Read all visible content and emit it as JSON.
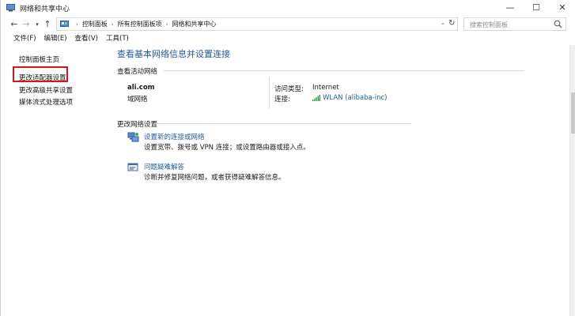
{
  "window": {
    "title": "网络和共享中心",
    "controls": {
      "minimize": "—",
      "maximize": "☐",
      "close": "✕"
    }
  },
  "address_bar": {
    "breadcrumbs": [
      "控制面板",
      "所有控制面板项",
      "网络和共享中心"
    ],
    "search_placeholder": "搜索控制面板"
  },
  "menu": [
    "文件(F)",
    "编辑(E)",
    "查看(V)",
    "工具(T)"
  ],
  "sidebar": {
    "items": [
      {
        "label": "控制面板主页"
      },
      {
        "label": "更改适配器设置",
        "highlighted": true
      },
      {
        "label": "更改高级共享设置"
      },
      {
        "label": "媒体流式处理选项"
      }
    ],
    "highlight_color": "#d4161c"
  },
  "main": {
    "title": "查看基本网络信息并设置连接",
    "active_networks_header": "查看活动网络",
    "network": {
      "name": "ali.com",
      "category": "域网络",
      "access_type_label": "访问类型:",
      "access_type_value": "Internet",
      "connection_label": "连接:",
      "connection_value": "WLAN (alibaba-inc)"
    },
    "change_settings_header": "更改网络设置",
    "tasks": [
      {
        "link": "设置新的连接或网络",
        "desc": "设置宽带、拨号或 VPN 连接；或设置路由器或接入点。",
        "icon": "network-setup-icon"
      },
      {
        "link": "问题疑难解答",
        "desc": "诊断并修复网络问题，或者获得疑难解答信息。",
        "icon": "troubleshoot-icon"
      }
    ],
    "link_color": "#1e5a9c"
  }
}
